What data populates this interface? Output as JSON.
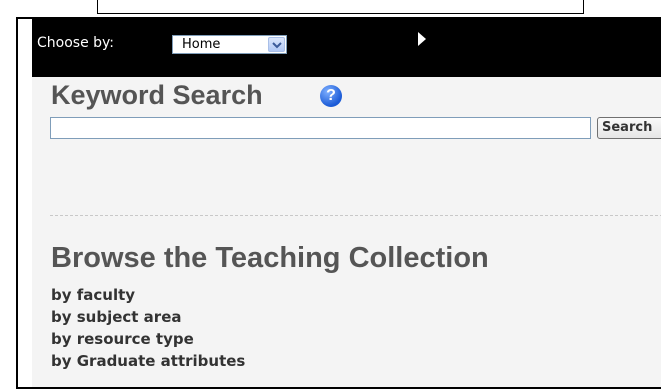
{
  "chooser": {
    "label": "Choose by:",
    "selected": "Home"
  },
  "keyword_search": {
    "title": "Keyword Search",
    "help_glyph": "?",
    "input_value": "",
    "button_label": "Search"
  },
  "browse": {
    "title": "Browse the Teaching Collection",
    "links": [
      "by faculty",
      "by subject area",
      "by resource type",
      "by Graduate attributes"
    ]
  },
  "icons": {
    "help": "help-icon",
    "dropdown": "chevron-down-icon",
    "go": "play-arrow-icon"
  },
  "colors": {
    "bar_background": "#000000",
    "heading_text": "#555555",
    "help_blue": "#1a5ad6"
  }
}
